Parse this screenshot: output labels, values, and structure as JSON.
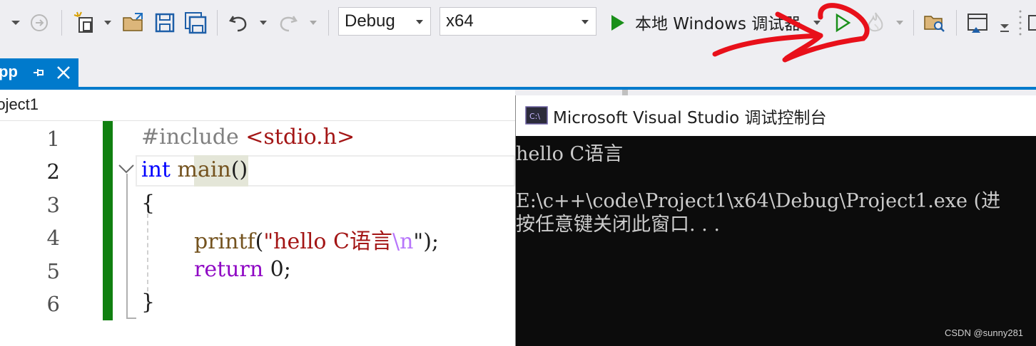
{
  "toolbar": {
    "config": "Debug",
    "platform": "x64",
    "run_target": "本地 Windows 调试器"
  },
  "tab": {
    "label": "pp",
    "pin_icon": "pin-icon",
    "close_icon": "close-icon"
  },
  "nav": {
    "project": "roject1"
  },
  "editor": {
    "line_numbers": [
      "1",
      "2",
      "3",
      "4",
      "5",
      "6"
    ],
    "code": {
      "l1_kw": "#include ",
      "l1_str": "<stdio.h>",
      "l2_kw": "int",
      "l2_sp": " ",
      "l2_fn": "main",
      "l2_paren": "()",
      "l3": "{",
      "l4_fn": "printf",
      "l4_open": "(",
      "l4_str": "\"hello C语言",
      "l4_esc": "\\n",
      "l4_close": "\");",
      "l5_kw": "return",
      "l5_rest": " 0;",
      "l6": "}"
    }
  },
  "console": {
    "title": "Microsoft Visual Studio 调试控制台",
    "icon": "console-app-icon",
    "lines": [
      "hello C语言",
      "",
      "E:\\c++\\code\\Project1\\x64\\Debug\\Project1.exe (进",
      "按任意键关闭此窗口. . ."
    ]
  },
  "watermark": "CSDN @sunny281",
  "colors": {
    "accent": "#007acc",
    "keyword": "#7a3cc0",
    "blue_keyword": "#0000ff",
    "string": "#a31515",
    "change_bar": "#108010",
    "annotation": "#e8101a",
    "run_green": "#1a8f1a"
  }
}
